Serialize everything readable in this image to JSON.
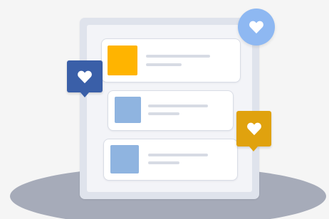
{
  "colors": {
    "background": "#f5f5f5",
    "device_frame": "#dfe3ec",
    "card": "#ffffff",
    "thumb_orange": "#ffb400",
    "thumb_blue": "#8fb4e0",
    "bubble_navy": "#3a5fa8",
    "bubble_gold": "#e0a20e",
    "circle_blue": "#8eb8f2",
    "floor_shadow": "#a6abb9"
  },
  "cards": [
    {
      "thumb_color": "orange"
    },
    {
      "thumb_color": "blue"
    },
    {
      "thumb_color": "blue"
    }
  ],
  "icons": [
    "heart-icon"
  ]
}
